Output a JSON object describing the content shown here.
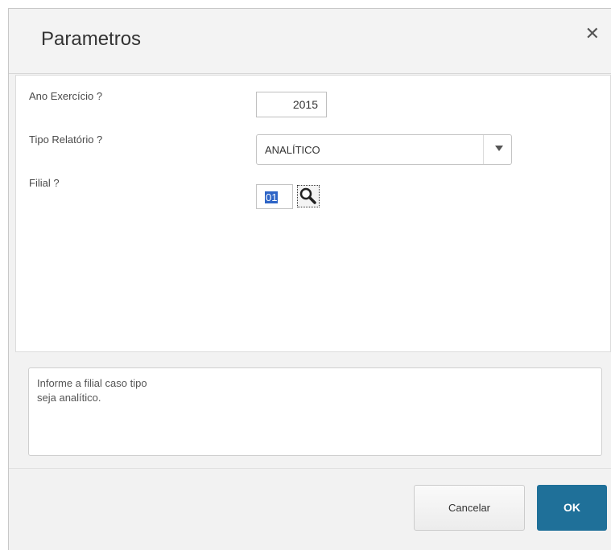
{
  "dialog": {
    "title": "Parametros",
    "close_icon": "close-icon"
  },
  "params": {
    "ano": {
      "label": "Ano Exercício ?",
      "value": "2015"
    },
    "tipo": {
      "label": "Tipo Relatório ?",
      "value": "ANALÍTICO",
      "arrow_icon": "chevron-down-icon"
    },
    "filial": {
      "label": "Filial ?",
      "value": "01",
      "lookup_icon": "search-icon"
    }
  },
  "help": {
    "line1": "Informe a filial caso tipo",
    "line2": "seja analítico."
  },
  "footer": {
    "cancel_label": "Cancelar",
    "ok_label": "OK"
  },
  "colors": {
    "ok_button": "#1f7099",
    "selection": "#2d64c6"
  }
}
